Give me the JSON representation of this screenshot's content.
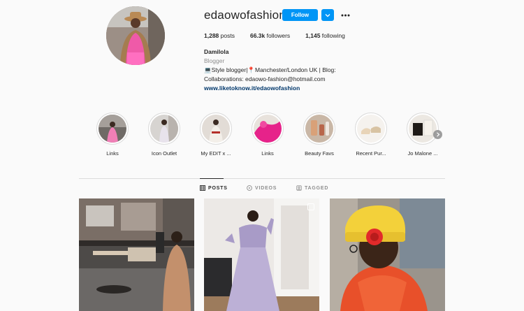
{
  "profile": {
    "username": "edaowofashion",
    "follow_label": "Follow",
    "stats": {
      "posts_num": "1,288",
      "posts_label": " posts",
      "followers_num": "66.3k",
      "followers_label": " followers",
      "following_num": "1,145",
      "following_label": " following"
    },
    "full_name": "Damilola",
    "category": "Blogger",
    "bio_line1": "💻Style blogger|📍Manchester/London UK | Blog:",
    "bio_line2": "Collaborations: edaowo-fashion@hotmail.com",
    "website": "www.liketoknow.it/edaowofashion"
  },
  "highlights": [
    {
      "label": "Links"
    },
    {
      "label": "Icon Outlet"
    },
    {
      "label": "My EDIT x ..."
    },
    {
      "label": "Links"
    },
    {
      "label": "Beauty Favs"
    },
    {
      "label": "Recent Pur..."
    },
    {
      "label": "Jo Malone ..."
    }
  ],
  "tabs": {
    "posts": "POSTS",
    "videos": "VIDEOS",
    "tagged": "TAGGED"
  },
  "colors": {
    "accent": "#0095f6",
    "link": "#00376b",
    "muted": "#8e8e8e",
    "border": "#dbdbdb"
  },
  "icons": {
    "dropdown": "chevron-down-icon",
    "more": "ellipsis-icon",
    "posts_tab": "grid-icon",
    "videos_tab": "play-circle-icon",
    "tagged_tab": "tag-icon",
    "multi_photo": "carousel-icon",
    "next": "chevron-right-icon"
  }
}
